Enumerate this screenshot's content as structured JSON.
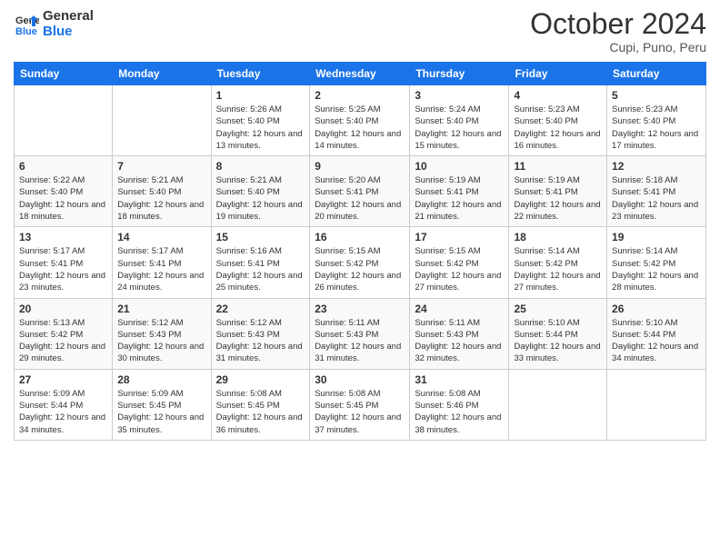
{
  "logo": {
    "line1": "General",
    "line2": "Blue"
  },
  "title": "October 2024",
  "subtitle": "Cupi, Puno, Peru",
  "days_of_week": [
    "Sunday",
    "Monday",
    "Tuesday",
    "Wednesday",
    "Thursday",
    "Friday",
    "Saturday"
  ],
  "weeks": [
    [
      {
        "day": "",
        "info": ""
      },
      {
        "day": "",
        "info": ""
      },
      {
        "day": "1",
        "sunrise": "Sunrise: 5:26 AM",
        "sunset": "Sunset: 5:40 PM",
        "daylight": "Daylight: 12 hours and 13 minutes."
      },
      {
        "day": "2",
        "sunrise": "Sunrise: 5:25 AM",
        "sunset": "Sunset: 5:40 PM",
        "daylight": "Daylight: 12 hours and 14 minutes."
      },
      {
        "day": "3",
        "sunrise": "Sunrise: 5:24 AM",
        "sunset": "Sunset: 5:40 PM",
        "daylight": "Daylight: 12 hours and 15 minutes."
      },
      {
        "day": "4",
        "sunrise": "Sunrise: 5:23 AM",
        "sunset": "Sunset: 5:40 PM",
        "daylight": "Daylight: 12 hours and 16 minutes."
      },
      {
        "day": "5",
        "sunrise": "Sunrise: 5:23 AM",
        "sunset": "Sunset: 5:40 PM",
        "daylight": "Daylight: 12 hours and 17 minutes."
      }
    ],
    [
      {
        "day": "6",
        "sunrise": "Sunrise: 5:22 AM",
        "sunset": "Sunset: 5:40 PM",
        "daylight": "Daylight: 12 hours and 18 minutes."
      },
      {
        "day": "7",
        "sunrise": "Sunrise: 5:21 AM",
        "sunset": "Sunset: 5:40 PM",
        "daylight": "Daylight: 12 hours and 18 minutes."
      },
      {
        "day": "8",
        "sunrise": "Sunrise: 5:21 AM",
        "sunset": "Sunset: 5:40 PM",
        "daylight": "Daylight: 12 hours and 19 minutes."
      },
      {
        "day": "9",
        "sunrise": "Sunrise: 5:20 AM",
        "sunset": "Sunset: 5:41 PM",
        "daylight": "Daylight: 12 hours and 20 minutes."
      },
      {
        "day": "10",
        "sunrise": "Sunrise: 5:19 AM",
        "sunset": "Sunset: 5:41 PM",
        "daylight": "Daylight: 12 hours and 21 minutes."
      },
      {
        "day": "11",
        "sunrise": "Sunrise: 5:19 AM",
        "sunset": "Sunset: 5:41 PM",
        "daylight": "Daylight: 12 hours and 22 minutes."
      },
      {
        "day": "12",
        "sunrise": "Sunrise: 5:18 AM",
        "sunset": "Sunset: 5:41 PM",
        "daylight": "Daylight: 12 hours and 23 minutes."
      }
    ],
    [
      {
        "day": "13",
        "sunrise": "Sunrise: 5:17 AM",
        "sunset": "Sunset: 5:41 PM",
        "daylight": "Daylight: 12 hours and 23 minutes."
      },
      {
        "day": "14",
        "sunrise": "Sunrise: 5:17 AM",
        "sunset": "Sunset: 5:41 PM",
        "daylight": "Daylight: 12 hours and 24 minutes."
      },
      {
        "day": "15",
        "sunrise": "Sunrise: 5:16 AM",
        "sunset": "Sunset: 5:41 PM",
        "daylight": "Daylight: 12 hours and 25 minutes."
      },
      {
        "day": "16",
        "sunrise": "Sunrise: 5:15 AM",
        "sunset": "Sunset: 5:42 PM",
        "daylight": "Daylight: 12 hours and 26 minutes."
      },
      {
        "day": "17",
        "sunrise": "Sunrise: 5:15 AM",
        "sunset": "Sunset: 5:42 PM",
        "daylight": "Daylight: 12 hours and 27 minutes."
      },
      {
        "day": "18",
        "sunrise": "Sunrise: 5:14 AM",
        "sunset": "Sunset: 5:42 PM",
        "daylight": "Daylight: 12 hours and 27 minutes."
      },
      {
        "day": "19",
        "sunrise": "Sunrise: 5:14 AM",
        "sunset": "Sunset: 5:42 PM",
        "daylight": "Daylight: 12 hours and 28 minutes."
      }
    ],
    [
      {
        "day": "20",
        "sunrise": "Sunrise: 5:13 AM",
        "sunset": "Sunset: 5:42 PM",
        "daylight": "Daylight: 12 hours and 29 minutes."
      },
      {
        "day": "21",
        "sunrise": "Sunrise: 5:12 AM",
        "sunset": "Sunset: 5:43 PM",
        "daylight": "Daylight: 12 hours and 30 minutes."
      },
      {
        "day": "22",
        "sunrise": "Sunrise: 5:12 AM",
        "sunset": "Sunset: 5:43 PM",
        "daylight": "Daylight: 12 hours and 31 minutes."
      },
      {
        "day": "23",
        "sunrise": "Sunrise: 5:11 AM",
        "sunset": "Sunset: 5:43 PM",
        "daylight": "Daylight: 12 hours and 31 minutes."
      },
      {
        "day": "24",
        "sunrise": "Sunrise: 5:11 AM",
        "sunset": "Sunset: 5:43 PM",
        "daylight": "Daylight: 12 hours and 32 minutes."
      },
      {
        "day": "25",
        "sunrise": "Sunrise: 5:10 AM",
        "sunset": "Sunset: 5:44 PM",
        "daylight": "Daylight: 12 hours and 33 minutes."
      },
      {
        "day": "26",
        "sunrise": "Sunrise: 5:10 AM",
        "sunset": "Sunset: 5:44 PM",
        "daylight": "Daylight: 12 hours and 34 minutes."
      }
    ],
    [
      {
        "day": "27",
        "sunrise": "Sunrise: 5:09 AM",
        "sunset": "Sunset: 5:44 PM",
        "daylight": "Daylight: 12 hours and 34 minutes."
      },
      {
        "day": "28",
        "sunrise": "Sunrise: 5:09 AM",
        "sunset": "Sunset: 5:45 PM",
        "daylight": "Daylight: 12 hours and 35 minutes."
      },
      {
        "day": "29",
        "sunrise": "Sunrise: 5:08 AM",
        "sunset": "Sunset: 5:45 PM",
        "daylight": "Daylight: 12 hours and 36 minutes."
      },
      {
        "day": "30",
        "sunrise": "Sunrise: 5:08 AM",
        "sunset": "Sunset: 5:45 PM",
        "daylight": "Daylight: 12 hours and 37 minutes."
      },
      {
        "day": "31",
        "sunrise": "Sunrise: 5:08 AM",
        "sunset": "Sunset: 5:46 PM",
        "daylight": "Daylight: 12 hours and 38 minutes."
      },
      {
        "day": "",
        "info": ""
      },
      {
        "day": "",
        "info": ""
      }
    ]
  ]
}
